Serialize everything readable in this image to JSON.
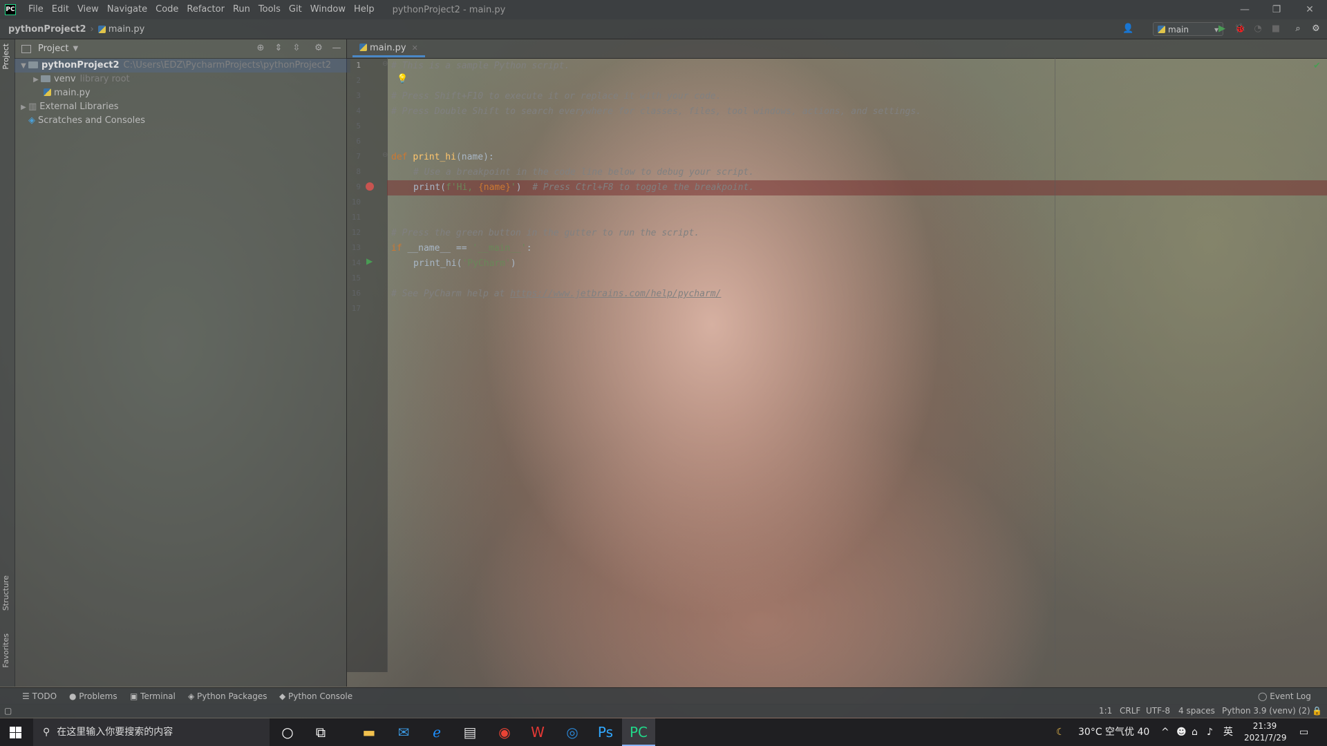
{
  "window": {
    "logo": "PC",
    "title": "pythonProject2 - main.py",
    "menu": [
      "File",
      "Edit",
      "View",
      "Navigate",
      "Code",
      "Refactor",
      "Run",
      "Tools",
      "Git",
      "Window",
      "Help"
    ]
  },
  "navbar": {
    "project": "pythonProject2",
    "file": "main.py",
    "run_config": "main"
  },
  "project_panel": {
    "title": "Project",
    "tree": [
      {
        "label": "pythonProject2",
        "hint": "C:\\Users\\EDZ\\PycharmProjects\\pythonProject2",
        "level": 0,
        "expanded": true
      },
      {
        "label": "venv",
        "hint": "library root",
        "level": 1,
        "expanded": false
      },
      {
        "label": "main.py",
        "hint": "",
        "level": 1
      },
      {
        "label": "External Libraries",
        "hint": "",
        "level": 0,
        "expanded": false
      },
      {
        "label": "Scratches and Consoles",
        "hint": "",
        "level": 0
      }
    ]
  },
  "side_labels": {
    "project": "Project",
    "structure": "Structure",
    "favorites": "Favorites"
  },
  "editor": {
    "tab": "main.py",
    "line_numbers": [
      "1",
      "2",
      "3",
      "4",
      "5",
      "6",
      "7",
      "8",
      "9",
      "10",
      "11",
      "12",
      "13",
      "14",
      "15",
      "16",
      "17"
    ],
    "code": {
      "l1": "# This is a sample Python script.",
      "l3": "# Press Shift+F10 to execute it or replace it with your code.",
      "l4": "# Press Double Shift to search everywhere for classes, files, tool windows, actions, and settings.",
      "l7_kw": "def ",
      "l7_fn": "print_hi",
      "l7_rest": "(name):",
      "l8": "# Use a breakpoint in the code line below to debug your script.",
      "l9_a": "print(",
      "l9_b": "f'Hi, ",
      "l9_c": "{name}",
      "l9_d": "'",
      "l9_e": ")  ",
      "l9_f": "# Press Ctrl+F8 to toggle the breakpoint.",
      "l12": "# Press the green button in the gutter to run the script.",
      "l13_kw": "if ",
      "l13_a": "__name__ == ",
      "l13_st": "'__main__'",
      "l13_b": ":",
      "l14_a": "print_hi(",
      "l14_st": "'PyCharm'",
      "l14_b": ")",
      "l16_a": "# See PyCharm help at ",
      "l16_link": "https://www.jetbrains.com/help/pycharm/"
    }
  },
  "tool_windows": [
    "TODO",
    "Problems",
    "Terminal",
    "Python Packages",
    "Python Console",
    "Event Log"
  ],
  "status": {
    "position": "1:1",
    "line_sep": "CRLF",
    "encoding": "UTF-8",
    "indent": "4 spaces",
    "interpreter": "Python 3.9 (venv) (2)"
  },
  "taskbar": {
    "search_placeholder": "在这里输入你要搜索的内容",
    "weather": "30°C 空气优 40",
    "ime": "英",
    "time": "21:39",
    "date": "2021/7/29"
  },
  "colors": {
    "comment": "#808080",
    "keyword": "#cc7832",
    "function": "#ffc66d",
    "string": "#6a8759",
    "breakpoint": "#c75450",
    "run": "#499c54"
  }
}
